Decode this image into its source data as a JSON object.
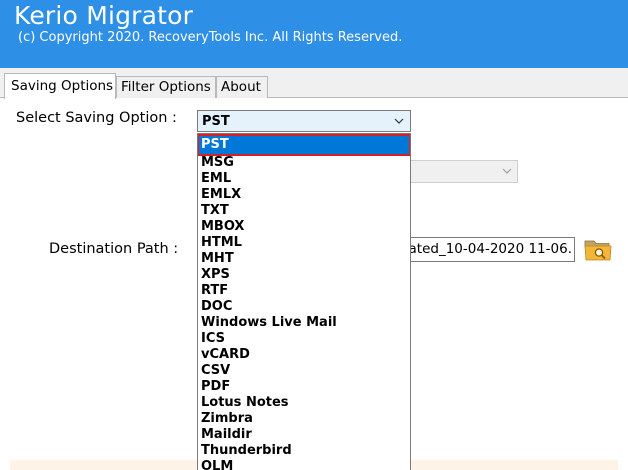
{
  "header": {
    "title": "Kerio Migrator",
    "copyright": "(c) Copyright 2020. RecoveryTools Inc. All Rights Reserved."
  },
  "tabs": [
    {
      "label": "Saving Options",
      "active": true
    },
    {
      "label": "Filter Options",
      "active": false
    },
    {
      "label": "About",
      "active": false
    }
  ],
  "saving": {
    "label": "Select Saving Option :",
    "selected": "PST",
    "options": [
      "PST",
      "MSG",
      "EML",
      "EMLX",
      "TXT",
      "MBOX",
      "HTML",
      "MHT",
      "XPS",
      "RTF",
      "DOC",
      "Windows Live Mail",
      "ICS",
      "vCARD",
      "CSV",
      "PDF",
      "Lotus Notes",
      "Zimbra",
      "Maildir",
      "Thunderbird",
      "OLM"
    ]
  },
  "destination": {
    "label": "Destination Path :",
    "value": "ated_10-04-2020 11-06."
  },
  "icons": {
    "combo_arrow": "chevron-down-icon",
    "folder": "folder-search-icon"
  },
  "colors": {
    "header": "#2e8fe6",
    "selection": "#0078d7",
    "highlight_border": "#d81e27"
  }
}
